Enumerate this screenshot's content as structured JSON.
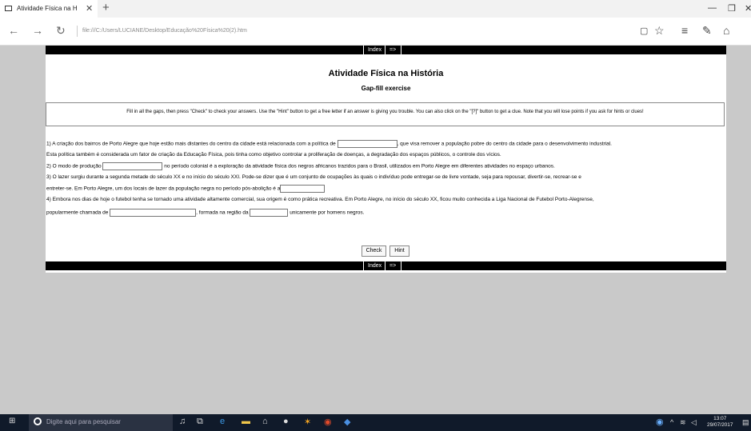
{
  "browser": {
    "tab_title": "Atividade Física na Histó",
    "url": "file:///C:/Users/LUCIANE/Desktop/Educação%20Física%20(2).htm"
  },
  "nav": {
    "index_label": "Index",
    "next_label": "=>"
  },
  "page": {
    "title": "Atividade Física na História",
    "subtitle": "Gap-fill exercise",
    "instructions": "Fill in all the gaps, then press \"Check\" to check your answers. Use the \"Hint\" button to get a free letter if an answer is giving you trouble. You can also click on the \"[?]\" button to get a clue. Note that you will lose points if you ask for hints or clues!",
    "q1_a": "1) A criação dos bairros de Porto Alegre que hoje estão mais distantes do centro da cidade está relacionada com a política de",
    "q1_b": ", que visa remover a população pobre do centro da cidade para o desenvolvimento industrial.",
    "q1_c": "Esta política também é considerada um fator de criação da Educação Física, pois tinha como objetivo controlar a proliferação de doenças, a degradação dos espaços públicos, o controle dos vícios.",
    "q2_a": "2) O modo de produção",
    "q2_b": "no período colonial é a exploração da atividade física dos negros africanos trazidos para o Brasil, utilizados em Porto Alegre em diferentes atividades no espaço urbanos.",
    "q3_a": "3) O lazer surgiu durante a segunda metade do século XX e no início do século XXI. Pode-se dizer que é um conjunto de ocupações às quais o indivíduo pode entregar-se de livre vontade, seja para repousar, divertir-se, recrear-se e",
    "q3_b": "entreter-se. Em Porto Alegre, um dos locais de lazer da população negra no período pós-abolição é a",
    "q4_a": "4) Embora nos dias de hoje o futebol tenha se tornado uma atividade altamente comercial, sua origem é como prática recreativa. Em Porto Alegre, no início do século XX, ficou muito conhecida a Liga Nacional de Futebol Porto-Alegrense,",
    "q4_b": "popularmente chamada de",
    "q4_c": ", formada na região da",
    "q4_d": "unicamente por homens negros.",
    "check_label": "Check",
    "hint_label": "Hint"
  },
  "taskbar": {
    "search_placeholder": "Digite aqui para pesquisar",
    "time": "13:07",
    "date": "29/07/2017"
  },
  "icons": [
    "back-arrow-icon",
    "forward-arrow-icon",
    "refresh-icon",
    "reading-view-icon",
    "favorite-star-icon",
    "hub-icon",
    "web-note-icon",
    "share-icon",
    "windows-icon",
    "search-icon",
    "cortana-icon"
  ]
}
